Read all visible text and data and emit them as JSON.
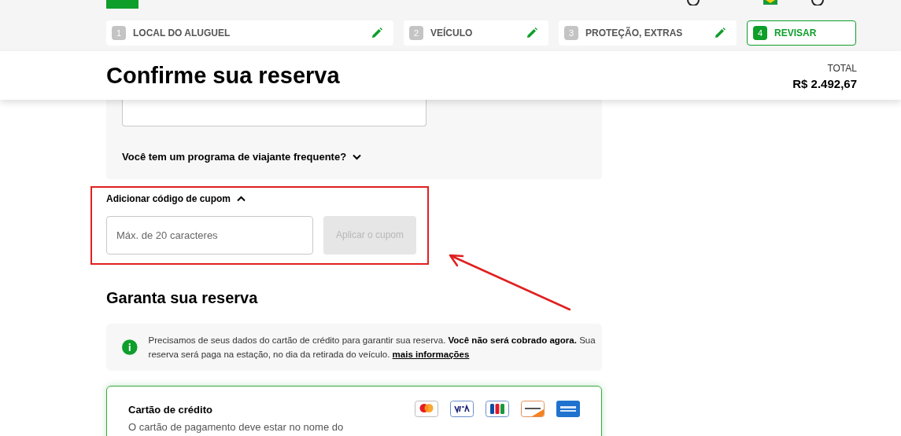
{
  "steps": [
    {
      "number": "1",
      "label": "LOCAL DO ALUGUEL",
      "editable": true,
      "selected": false
    },
    {
      "number": "2",
      "label": "VEÍCULO",
      "editable": true,
      "selected": false
    },
    {
      "number": "3",
      "label": "PROTEÇÃO, EXTRAS",
      "editable": true,
      "selected": false
    },
    {
      "number": "4",
      "label": "REVISAR",
      "editable": false,
      "selected": true
    }
  ],
  "summary": {
    "title": "Confirme sua reserva",
    "total_label": "TOTAL",
    "total": "R$ 2.492,67"
  },
  "loyalty": {
    "question": "Você tem um programa de viajante frequente?",
    "expanded": false
  },
  "coupon": {
    "label": "Adicionar código de cupom",
    "expanded": true,
    "placeholder": "Máx. de 20 caracteres",
    "button": "Aplicar o cupom",
    "button_disabled": true
  },
  "guarantee": {
    "title": "Garanta sua reserva",
    "notice": "Precisamos de seus dados do cartão de crédito para garantir sua reserva. **Você não será cobrado agora.** Sua reserva será paga na estação, no dia da retirada do veículo.",
    "link": "mais informações"
  },
  "payment": {
    "title": "Cartão de crédito",
    "selected": true,
    "note": "O cartão de pagamento deve estar no nome do",
    "cards": [
      {
        "kind": "mastercard"
      },
      {
        "kind": "visa"
      },
      {
        "kind": "jcb"
      },
      {
        "kind": "discover"
      },
      {
        "kind": "amex"
      }
    ]
  }
}
